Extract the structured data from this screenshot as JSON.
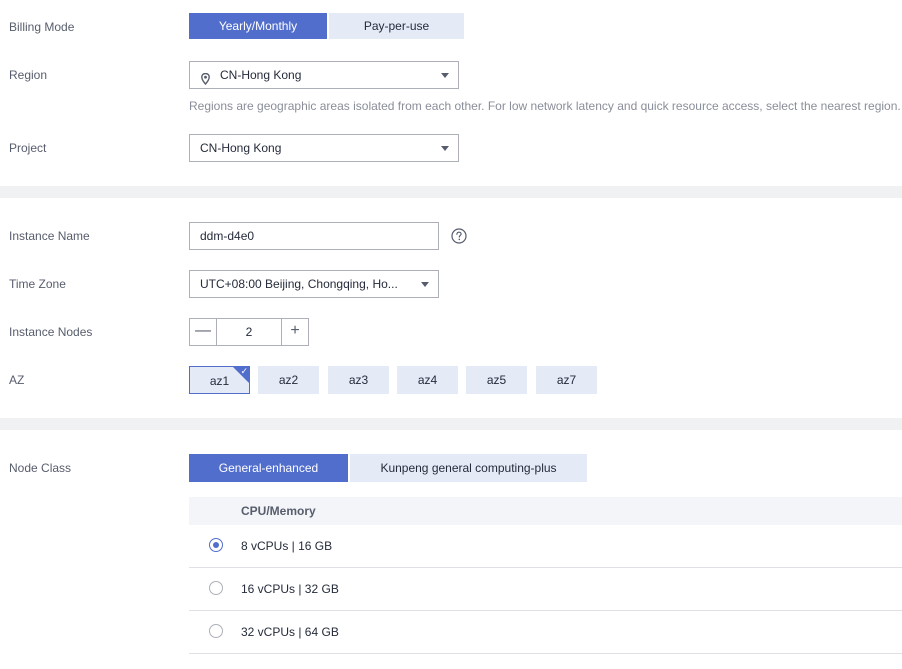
{
  "billing": {
    "label": "Billing Mode",
    "options": [
      "Yearly/Monthly",
      "Pay-per-use"
    ],
    "selected": "Yearly/Monthly"
  },
  "region": {
    "label": "Region",
    "value": "CN-Hong Kong",
    "hint": "Regions are geographic areas isolated from each other. For low network latency and quick resource access, select the nearest region."
  },
  "project": {
    "label": "Project",
    "value": "CN-Hong Kong"
  },
  "instance_name": {
    "label": "Instance Name",
    "value": "ddm-d4e0"
  },
  "time_zone": {
    "label": "Time Zone",
    "value": "UTC+08:00 Beijing, Chongqing, Ho..."
  },
  "instance_nodes": {
    "label": "Instance Nodes",
    "value": "2",
    "minus": "—",
    "plus": "+"
  },
  "az": {
    "label": "AZ",
    "options": [
      "az1",
      "az2",
      "az3",
      "az4",
      "az5",
      "az7"
    ],
    "selected": "az1"
  },
  "node_class": {
    "label": "Node Class",
    "tabs": [
      "General-enhanced",
      "Kunpeng general computing-plus"
    ],
    "selected_tab": "General-enhanced",
    "column_header": "CPU/Memory",
    "rows": [
      "8 vCPUs | 16 GB",
      "16 vCPUs | 32 GB",
      "32 vCPUs | 64 GB"
    ],
    "selected_row": "8 vCPUs | 16 GB"
  },
  "colors": {
    "accent": "#526ecc",
    "accent_light": "#e5eaf7",
    "band": "#f0f1f3"
  },
  "icons": {
    "location": "location-pin-icon",
    "help": "help-circle-icon",
    "caret": "caret-down-icon"
  }
}
